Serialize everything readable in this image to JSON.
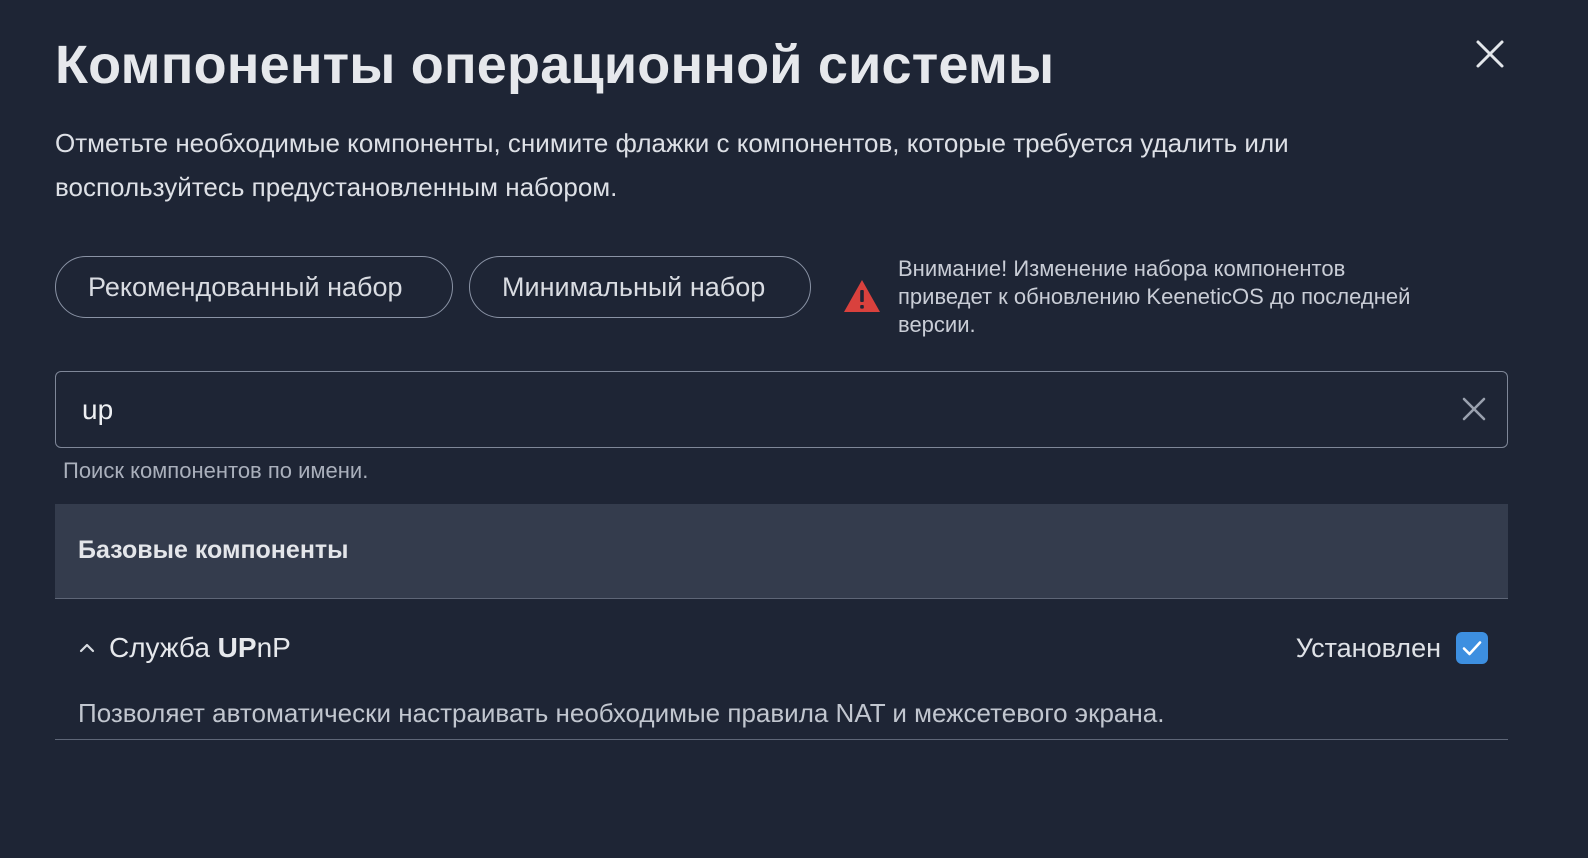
{
  "dialog": {
    "title": "Компоненты операционной системы",
    "description": "Отметьте необходимые компоненты, снимите флажки с компонентов, которые требуется удалить или воспользуйтесь предустановленным набором.",
    "close_icon": "close-icon"
  },
  "presets": {
    "recommended_label": "Рекомендованный набор",
    "minimal_label": "Минимальный набор"
  },
  "warning": {
    "icon": "warning-icon",
    "color": "#d9413d",
    "text": "Внимание! Изменение набора компонентов приведет к обновлению KeeneticOS до последней версии."
  },
  "search": {
    "value": "up",
    "hint": "Поиск компонентов по имени.",
    "clear_icon": "close-icon"
  },
  "groups": [
    {
      "title": "Базовые компоненты",
      "components": [
        {
          "name_prefix": "Служба ",
          "name_highlight": "UP",
          "name_suffix": "nP",
          "expanded": true,
          "status": "Установлен",
          "checked": true,
          "description": "Позволяет автоматически настраивать необходимые правила NAT и межсетевого экрана."
        }
      ]
    }
  ],
  "colors": {
    "background": "#1e2535",
    "group_header": "#343c4d",
    "checkbox_accent": "#3d8fe0"
  }
}
